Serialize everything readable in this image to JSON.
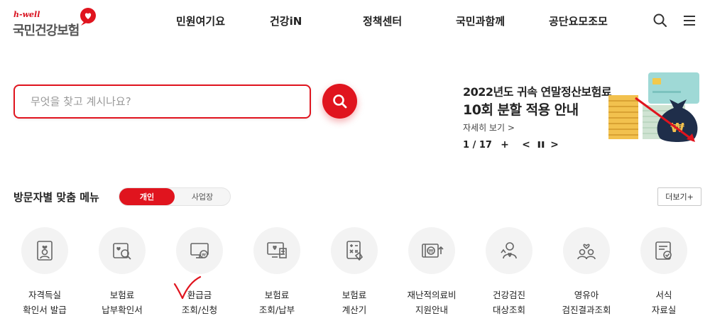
{
  "logo": {
    "sub": "h-well",
    "main": "국민건강보험"
  },
  "nav": [
    "민원여기요",
    "건강iN",
    "정책센터",
    "국민과함께",
    "공단요모조모"
  ],
  "search": {
    "placeholder": "무엇을 찾고 계시나요?"
  },
  "banner": {
    "title_line1": "2022년도 귀속 연말정산보험료",
    "title_line2": "10회 분할 적용 안내",
    "more": "자세히 보기 >",
    "counter": "1 / 17",
    "plus": "+",
    "prev": "<",
    "pause": "❚❚",
    "next": ">"
  },
  "custom_menu": {
    "title": "방문자별 맞춤 메뉴",
    "tab_personal": "개인",
    "tab_business": "사업장",
    "more": "더보기+"
  },
  "services": [
    {
      "label": "자격득실\n확인서 발급",
      "icon": "certificate-user-icon"
    },
    {
      "label": "보험료\n납부확인서",
      "icon": "payment-search-icon"
    },
    {
      "label": "환급금\n조회/신청",
      "icon": "refund-monitor-icon"
    },
    {
      "label": "보험료\n조회/납부",
      "icon": "premium-monitor-icon"
    },
    {
      "label": "보험료\n계산기",
      "icon": "calculator-icon"
    },
    {
      "label": "재난적의료비\n지원안내",
      "icon": "medical-support-icon"
    },
    {
      "label": "건강검진\n대상조회",
      "icon": "health-checkup-icon"
    },
    {
      "label": "영유아\n검진결과조회",
      "icon": "infant-checkup-icon"
    },
    {
      "label": "서식\n자료실",
      "icon": "form-library-icon"
    }
  ],
  "colors": {
    "accent": "#e0141e",
    "icon_stroke": "#666666",
    "circle_bg": "#f3f3f3"
  }
}
